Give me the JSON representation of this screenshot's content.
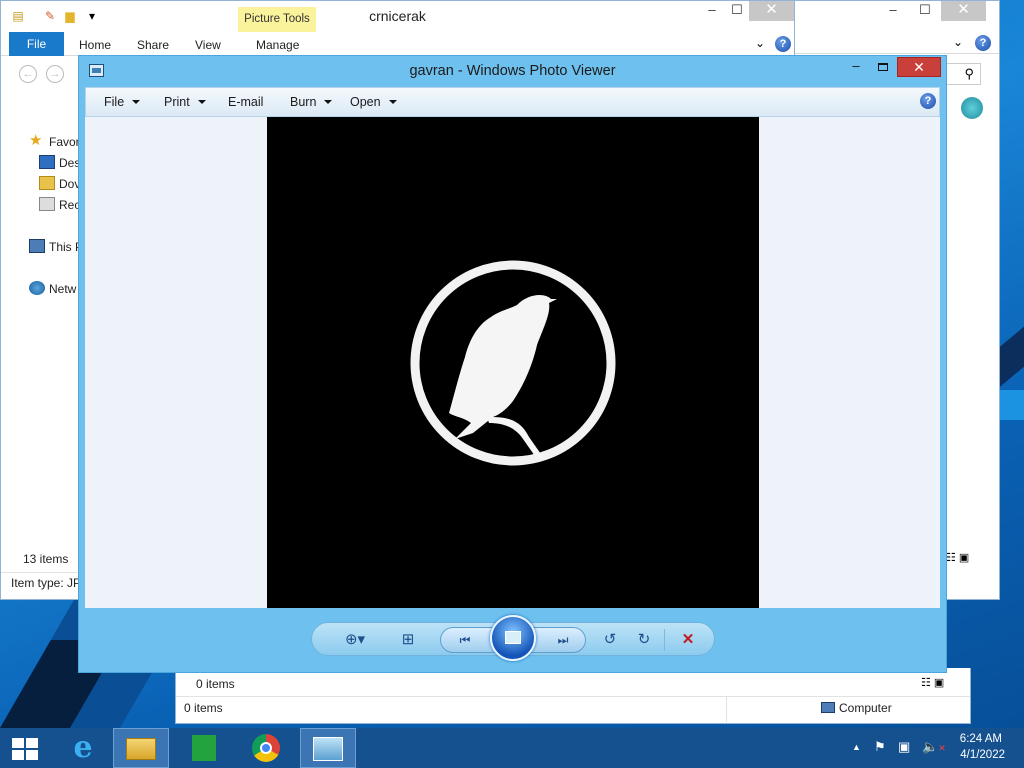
{
  "explorer_main": {
    "title": "crnicerak",
    "picture_tools": "Picture Tools",
    "tabs": [
      "Home",
      "Share",
      "View",
      "Manage"
    ],
    "file_tab": "File",
    "nav": [
      "Favor",
      "Des",
      "Dov",
      "Rec",
      "This P",
      "Netw"
    ],
    "item_count": "13 items",
    "item_type": "Item type: JP"
  },
  "explorer_bottom": {
    "items_top": "0 items",
    "items_status": "0 items",
    "location": "Computer"
  },
  "viewer": {
    "title": "gavran - Windows Photo Viewer",
    "menus": [
      "File",
      "Print",
      "E-mail",
      "Burn",
      "Open"
    ],
    "help": "?",
    "photo_description": "white raven silhouette in circle on black"
  },
  "taskbar": {
    "time": "6:24 AM",
    "date": "4/1/2022"
  },
  "colors": {
    "viewer_frame": "#6ec1ee",
    "close_red": "#c9403b",
    "file_tab_blue": "#1979ca",
    "taskbar": "#15508f"
  }
}
